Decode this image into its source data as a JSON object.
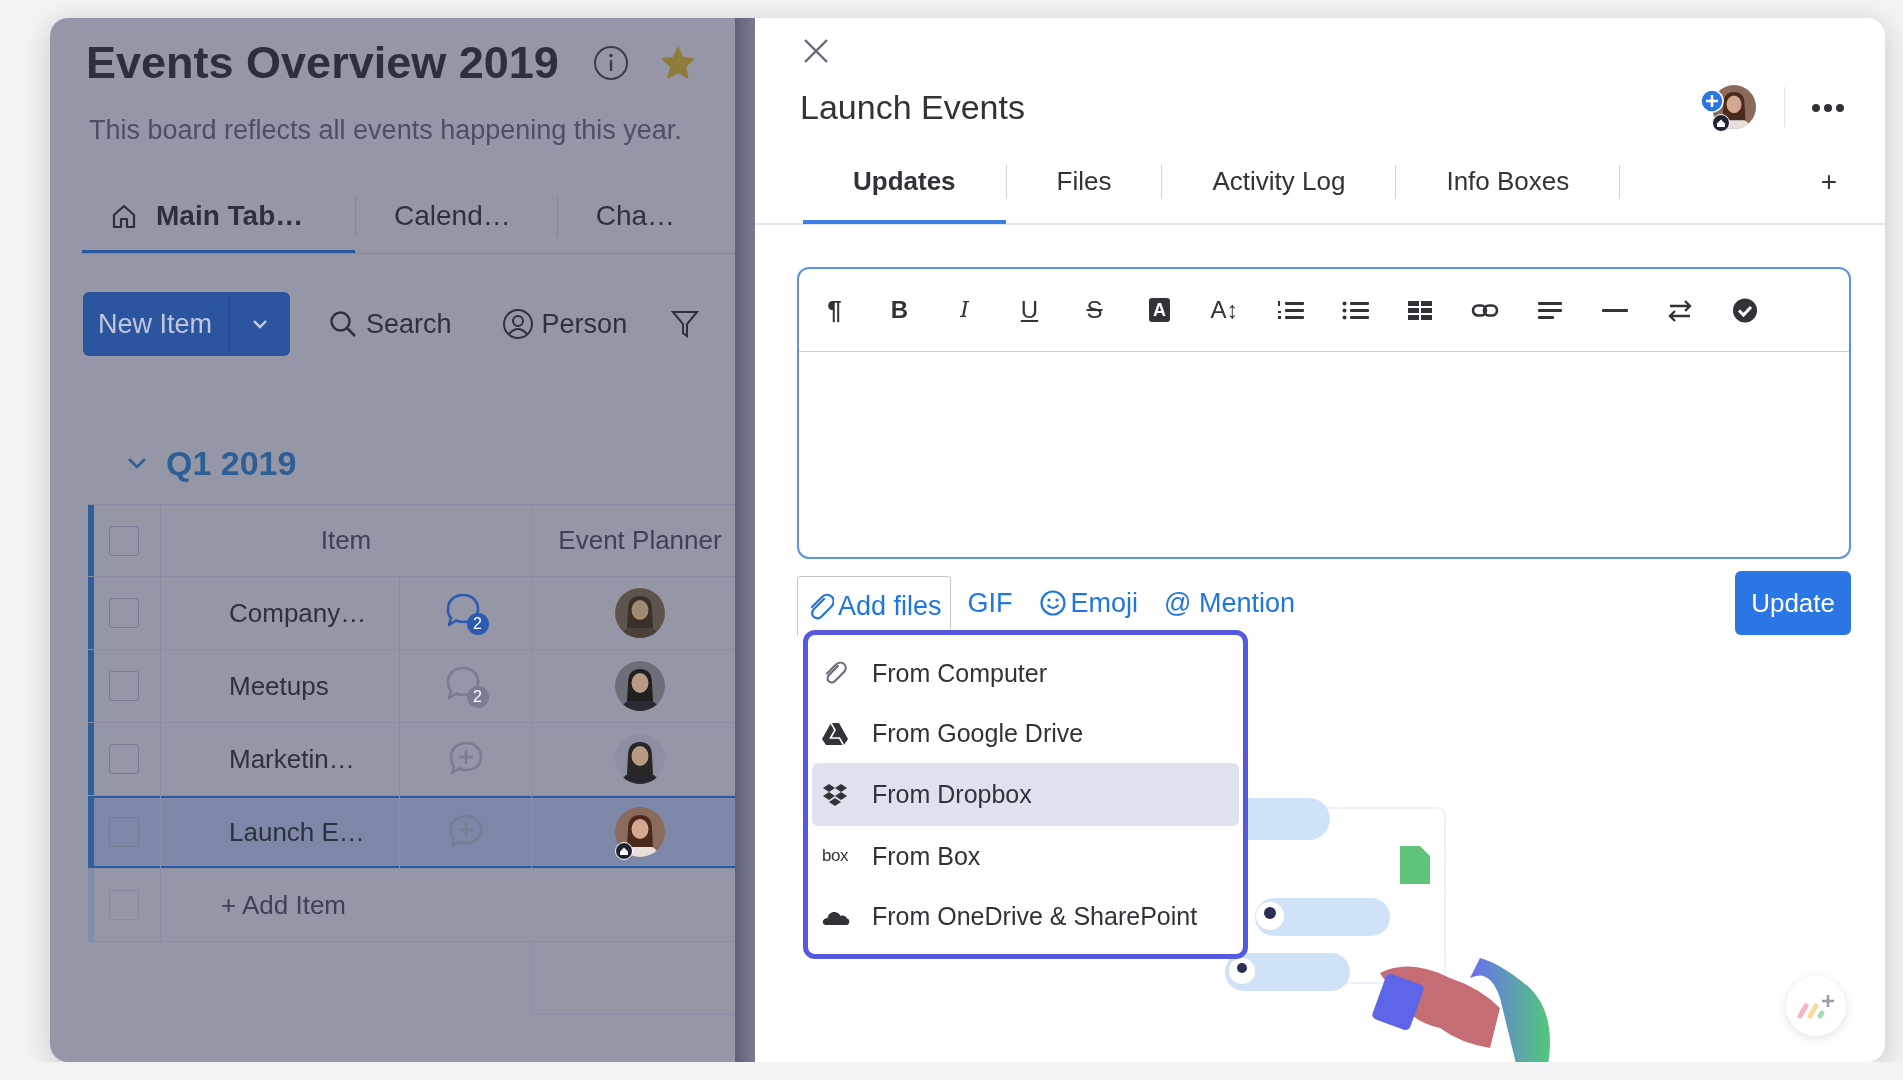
{
  "board": {
    "title": "Events Overview 2019",
    "starred": true,
    "description": "This board reflects all events happening this year.",
    "tabs": [
      {
        "label": "Main Tab…",
        "kind": "home",
        "selected": true
      },
      {
        "label": "Calend…",
        "kind": "plain",
        "selected": false
      },
      {
        "label": "Cha…",
        "kind": "plain",
        "selected": false
      }
    ],
    "new_item": "New Item",
    "search": "Search",
    "person": "Person",
    "group": {
      "title": "Q1 2019",
      "expanded": true,
      "all_checked": false,
      "columns": [
        "Item",
        "Event Planner"
      ],
      "rows": [
        {
          "name": "Company…",
          "checked": false,
          "selected": false,
          "updates": {
            "kind": "count",
            "count": "2",
            "unread": true
          },
          "planner": {
            "kind": "picture",
            "home_badge": false
          }
        },
        {
          "name": "Meetups",
          "checked": false,
          "selected": false,
          "updates": {
            "kind": "count",
            "count": "2",
            "unread": false
          },
          "planner": {
            "kind": "picture",
            "home_badge": false
          }
        },
        {
          "name": "Marketin…",
          "checked": false,
          "selected": false,
          "updates": {
            "kind": "add"
          },
          "planner": {
            "kind": "picture",
            "home_badge": false
          }
        },
        {
          "name": "Launch E…",
          "checked": false,
          "selected": true,
          "updates": {
            "kind": "add"
          },
          "planner": {
            "kind": "picture",
            "home_badge": true
          }
        }
      ],
      "add_item": {
        "label": "+ Add Item",
        "checked": false
      }
    }
  },
  "panel": {
    "title": "Launch Events",
    "subscriber": {
      "kind": "picture",
      "home_badge": true
    },
    "tabs": [
      {
        "label": "Updates",
        "selected": true
      },
      {
        "label": "Files",
        "selected": false
      },
      {
        "label": "Activity Log",
        "selected": false
      },
      {
        "label": "Info Boxes",
        "selected": false
      }
    ],
    "add_tab": "+",
    "toolbar": [
      {
        "kind": "paragraph",
        "glyph": "¶"
      },
      {
        "kind": "bold",
        "glyph": "B"
      },
      {
        "kind": "italic",
        "glyph": "I"
      },
      {
        "kind": "underline",
        "glyph": "U"
      },
      {
        "kind": "strike",
        "glyph": "S"
      },
      {
        "kind": "color",
        "glyph": "A"
      },
      {
        "kind": "size",
        "glyph": "A↕"
      },
      {
        "kind": "ordered_list"
      },
      {
        "kind": "bullet_list"
      },
      {
        "kind": "table"
      },
      {
        "kind": "link"
      },
      {
        "kind": "align"
      },
      {
        "kind": "rule"
      },
      {
        "kind": "direction"
      },
      {
        "kind": "check"
      }
    ],
    "actions": [
      {
        "kind": "attach",
        "label": "Add files",
        "open": true
      },
      {
        "kind": "gif",
        "label": "GIF"
      },
      {
        "kind": "emoji",
        "label": "Emoji"
      },
      {
        "kind": "mention",
        "label": "@ Mention"
      }
    ],
    "submit": "Update",
    "attach_menu": [
      {
        "kind": "computer",
        "label": "From Computer",
        "selected": false
      },
      {
        "kind": "google_drive",
        "label": "From Google Drive",
        "selected": false
      },
      {
        "kind": "dropbox",
        "label": "From Dropbox",
        "selected": true
      },
      {
        "kind": "box",
        "logo": "box",
        "label": "From Box",
        "selected": false
      },
      {
        "kind": "onedrive",
        "label": "From OneDrive & SharePoint",
        "selected": false
      }
    ]
  }
}
